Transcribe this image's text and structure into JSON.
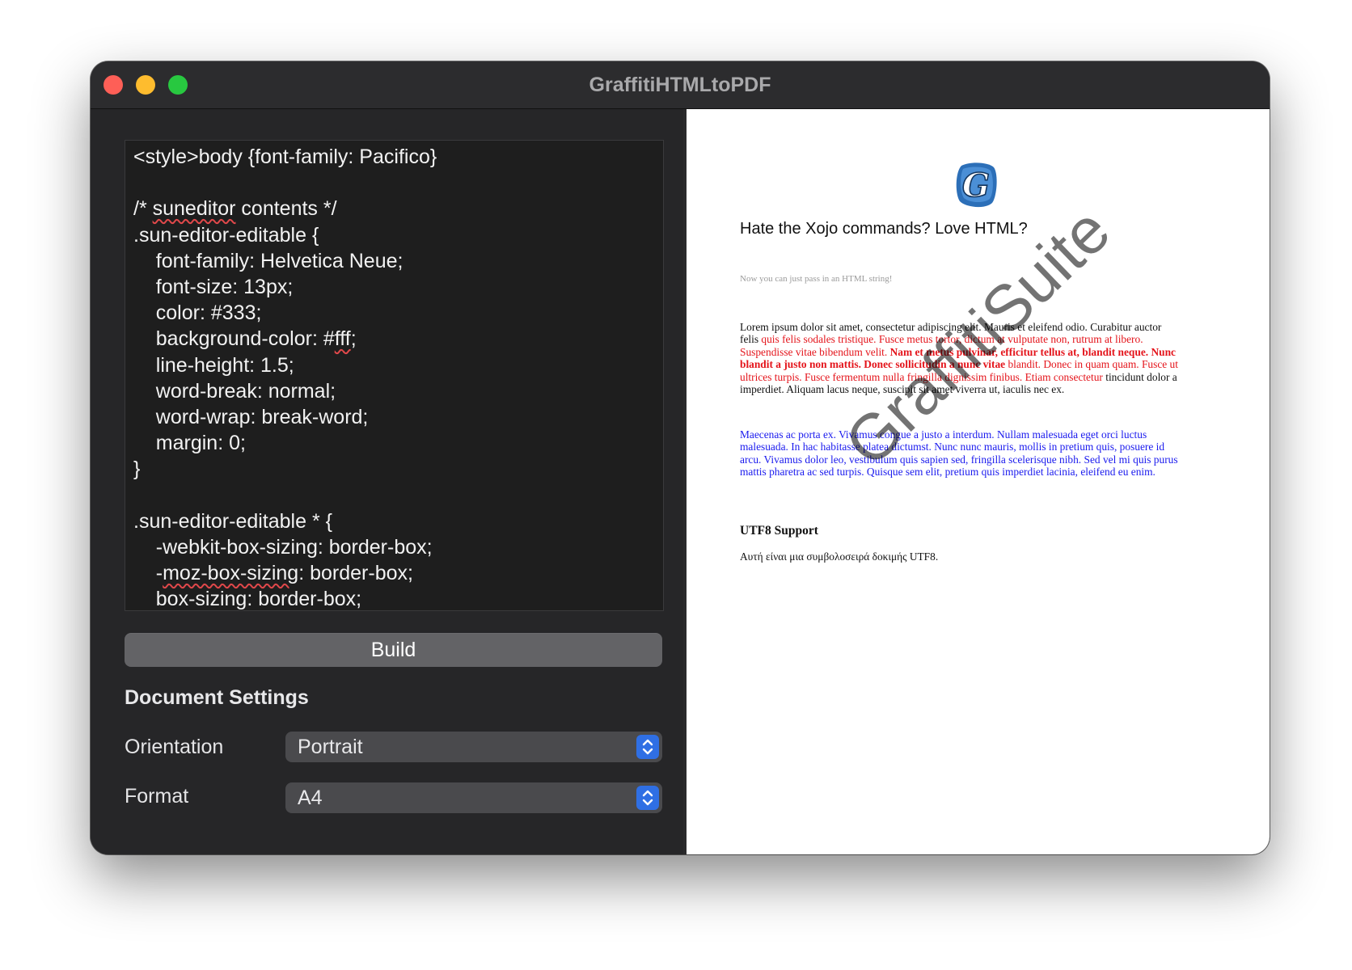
{
  "window": {
    "title": "GraffitiHTMLtoPDF"
  },
  "editor": {
    "code_lines": [
      "<style>body {font-family: Pacifico}",
      "",
      "/* suneditor contents */",
      ".sun-editor-editable {",
      "    font-family: Helvetica Neue;",
      "    font-size: 13px;",
      "    color: #333;",
      "    background-color: #fff;",
      "    line-height: 1.5;",
      "    word-break: normal;",
      "    word-wrap: break-word;",
      "    margin: 0;",
      "}",
      "",
      ".sun-editor-editable * {",
      "    -webkit-box-sizing: border-box;",
      "    -moz-box-sizing: border-box;",
      "    box-sizing: border-box;"
    ],
    "misspelled_words": [
      "suneditor",
      "fff",
      "moz-box-sizing"
    ]
  },
  "build_label": "Build",
  "settings": {
    "title": "Document Settings",
    "orientation": {
      "label": "Orientation",
      "value": "Portrait"
    },
    "format": {
      "label": "Format",
      "value": "A4"
    }
  },
  "preview": {
    "logo_letter": "G",
    "heading": "Hate the Xojo commands? Love HTML?",
    "subheading": "Now you can just pass in an HTML string!",
    "watermark": "GraffitiSuite",
    "para1": {
      "a": "Lorem ipsum dolor sit amet, consectetur adipiscing elit. Mauris et eleifend odio. Curabitur auctor felis ",
      "b": "quis felis sodales tristique. Fusce metus tortor, dictum at vulputate non, rutrum at libero. Suspendisse vitae bibendum velit. ",
      "c": "Nam et metus pulvinar, efficitur tellus at, blandit neque. Nunc blandit a justo non mattis. Donec sollicitudin a nunc vitae",
      "d": " blandit. Donec in quam quam. Fusce ut ultrices turpis. Fusce fermentum nulla fringilla dignissim finibus. Etiam consectetur",
      "e": " tincidunt dolor a imperdiet. Aliquam lacus neque, suscipit sit amet viverra ut, iaculis nec ex."
    },
    "para2": "Maecenas ac porta ex. Vivamus congue a justo a interdum. Nullam malesuada eget orci luctus malesuada. In hac habitasse platea dictumst. Nunc nunc mauris, mollis in pretium quis, posuere id arcu. Vivamus dolor leo, vestibulum quis sapien sed, fringilla scelerisque nibh. Sed vel mi quis purus mattis pharetra ac sed turpis. Quisque sem elit, pretium quis imperdiet lacinia, eleifend eu enim.",
    "utf_heading": "UTF8 Support",
    "utf_text": "Αυτή είναι μια συμβολοσειρά δοκιμής UTF8."
  },
  "colors": {
    "close": "#fe5f57",
    "minimize": "#febc2e",
    "maximize": "#28c840",
    "accent": "#2f6fe4",
    "red_text": "#e4141b",
    "blue_text": "#1a1aee"
  },
  "icons": [
    "close-icon",
    "minimize-icon",
    "maximize-icon",
    "chevron-updown-icon",
    "graffiti-logo-icon"
  ]
}
